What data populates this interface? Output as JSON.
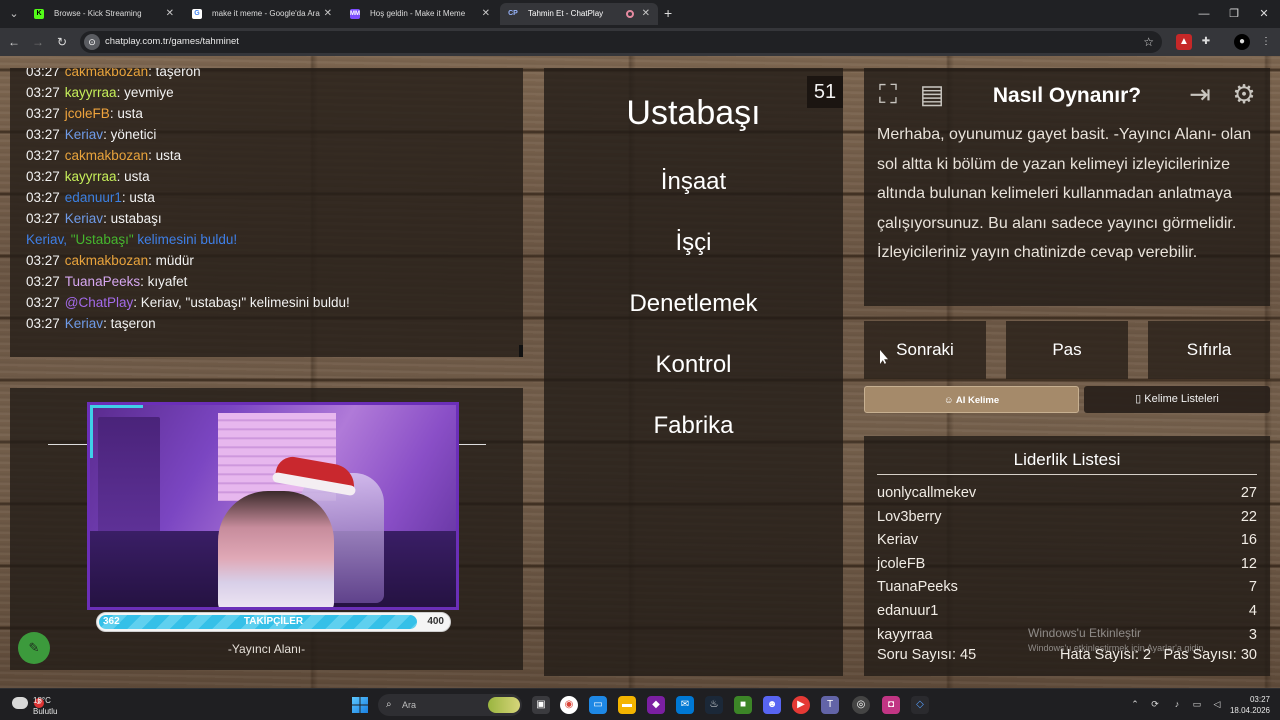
{
  "browser": {
    "tabs": [
      {
        "title": "Browse - Kick Streaming",
        "icon": "kick-icon"
      },
      {
        "title": "make it meme - Google'da Ara",
        "icon": "google-icon"
      },
      {
        "title": "Hoş geldin - Make it Meme",
        "icon": "mim-icon"
      },
      {
        "title": "Tahmin Et - ChatPlay",
        "icon": "chatplay-icon",
        "active": true
      }
    ],
    "url": "chatplay.com.tr/games/tahminet"
  },
  "chat": {
    "messages": [
      {
        "time": "03:27",
        "user": "cakmakbozan",
        "user_color": "#e8a33c",
        "text": ": taşeron"
      },
      {
        "time": "03:27",
        "user": "kayyrraa",
        "user_color": "#c6ef5a",
        "text": ": yevmiye"
      },
      {
        "time": "03:27",
        "user": "jcoleFB",
        "user_color": "#f0a43c",
        "text": ": usta"
      },
      {
        "time": "03:27",
        "user": "Keriav",
        "user_color": "#6f9be8",
        "text": ": yönetici"
      },
      {
        "time": "03:27",
        "user": "cakmakbozan",
        "user_color": "#e8a33c",
        "text": ": usta"
      },
      {
        "time": "03:27",
        "user": "kayyrraa",
        "user_color": "#c6ef5a",
        "text": ": usta"
      },
      {
        "time": "03:27",
        "user": "edanuur1",
        "user_color": "#3c7fe0",
        "text": ": usta"
      },
      {
        "time": "03:27",
        "user": "Keriav",
        "user_color": "#6f9be8",
        "text": ": ustabaşı"
      }
    ],
    "system": {
      "prefix": "Keriav, ",
      "word": "\"Ustabaşı\"",
      "suffix": " kelimesini buldu!"
    },
    "messages2": [
      {
        "time": "03:27",
        "user": "cakmakbozan",
        "user_color": "#e8a33c",
        "text": ": müdür"
      },
      {
        "time": "03:27",
        "user": "TuanaPeeks",
        "user_color": "#d6a7f0",
        "text": ": kıyafet"
      },
      {
        "time": "03:27",
        "user": "@ChatPlay",
        "user_color": "#a36ae8",
        "text": ": Keriav, \"ustabaşı\" kelimesini buldu!"
      },
      {
        "time": "03:27",
        "user": "Keriav",
        "user_color": "#6f9be8",
        "text": ": taşeron"
      }
    ]
  },
  "streamer": {
    "followers_label": "TAKİPÇİLER",
    "followers_min": "362",
    "followers_max": "400",
    "followers_progress": 0.9,
    "caption": "-Yayıncı Alanı-"
  },
  "game": {
    "counter": "51",
    "target_word": "Ustabaşı",
    "taboo_words": [
      "İnşaat",
      "İşçi",
      "Denetlemek",
      "Kontrol",
      "Fabrika"
    ]
  },
  "howto": {
    "title": "Nasıl Oynanır?",
    "text": "Merhaba, oyunumuz gayet basit. -Yayıncı Alanı- olan sol altta ki bölüm de yazan kelimeyi izleyicilerinize altında bulunan kelimeleri kullanmadan anlatmaya çalışıyorsunuz. Bu alanı sadece yayıncı görmelidir. İzleyicileriniz yayın chatinizde cevap verebilir."
  },
  "controls": {
    "next": "Sonraki",
    "pass": "Pas",
    "reset": "Sıfırla",
    "ai_word": "AI Kelime",
    "word_lists": "Kelime Listeleri"
  },
  "leaderboard": {
    "title": "Liderlik Listesi",
    "rows": [
      {
        "name": "uonlycallmekev",
        "score": "27"
      },
      {
        "name": "Lov3berry",
        "score": "22"
      },
      {
        "name": "Keriav",
        "score": "16"
      },
      {
        "name": "jcoleFB",
        "score": "12"
      },
      {
        "name": "TuanaPeeks",
        "score": "7"
      },
      {
        "name": "edanuur1",
        "score": "4"
      },
      {
        "name": "kayyrraa",
        "score": "3"
      }
    ],
    "stats": {
      "questions": "Soru Sayısı: 45",
      "errors": "Hata Sayısı: 2",
      "passes": "Pas Sayısı: 30"
    }
  },
  "watermark": {
    "line1": "Windows'u Etkinleştir",
    "line2": "Windows'u etkinleştirmek için Ayarlar'a gidin."
  },
  "taskbar": {
    "weather_temp": "18°C",
    "weather_desc": "Bulutlu",
    "weather_badge": "2",
    "search_placeholder": "Ara",
    "time": "03:27",
    "date": "18.04.2026"
  }
}
